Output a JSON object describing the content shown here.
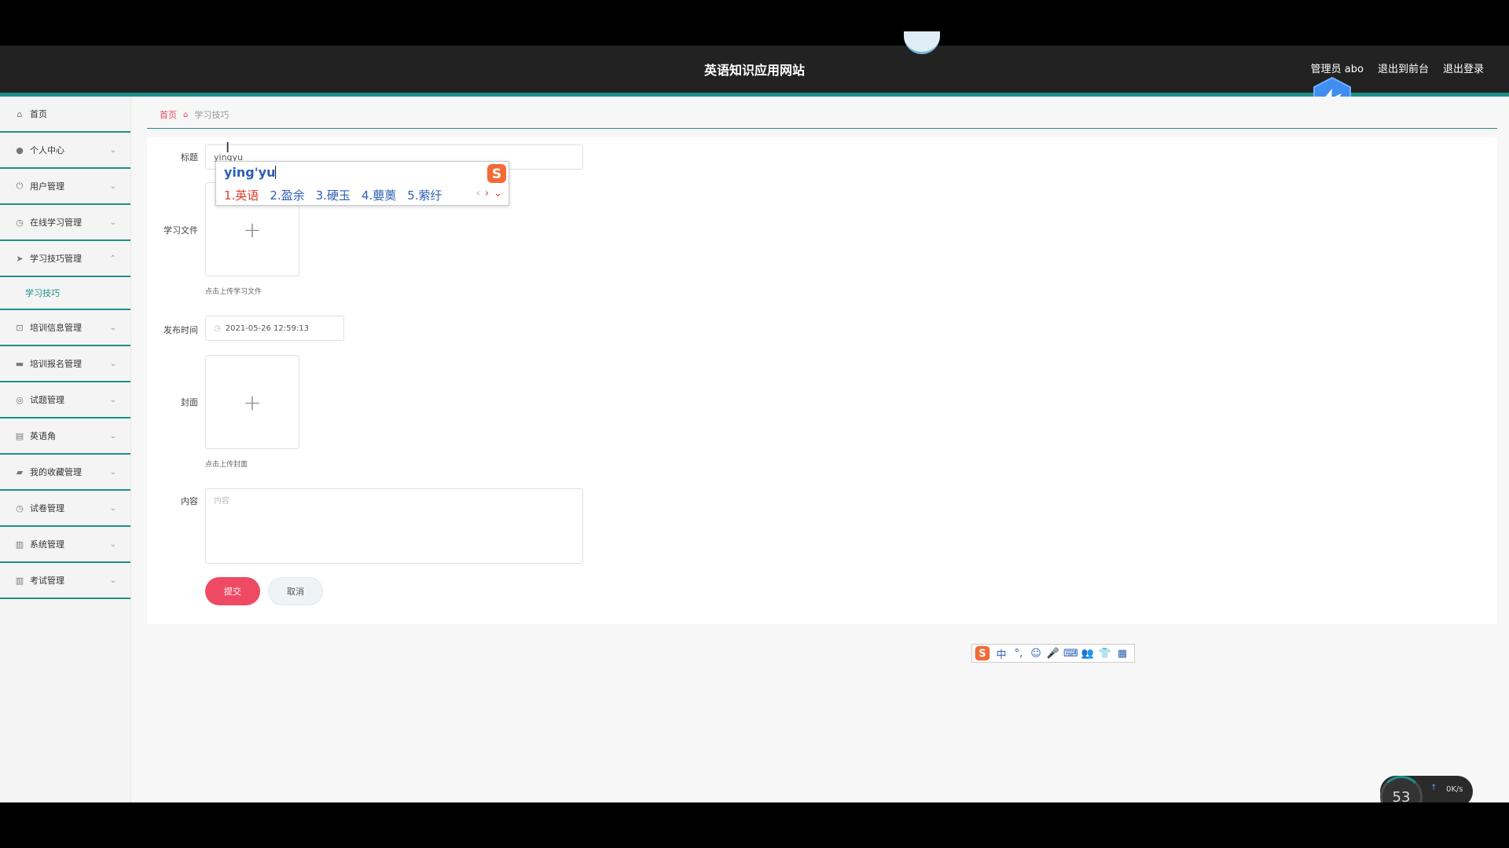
{
  "header": {
    "site_title": "英语知识应用网站",
    "admin_label": "管理员 abo",
    "back_to_front": "退出到前台",
    "logout": "退出登录"
  },
  "sidebar": {
    "items": [
      {
        "label": "首页",
        "icon": "home-icon"
      },
      {
        "label": "个人中心",
        "icon": "user-icon"
      },
      {
        "label": "用户管理",
        "icon": "power-icon"
      },
      {
        "label": "在线学习管理",
        "icon": "clock-icon"
      },
      {
        "label": "学习技巧管理",
        "icon": "send-icon"
      },
      {
        "label": "学习技巧",
        "icon": ""
      },
      {
        "label": "培训信息管理",
        "icon": "crop-icon"
      },
      {
        "label": "培训报名管理",
        "icon": "chat-icon"
      },
      {
        "label": "试题管理",
        "icon": "target-icon"
      },
      {
        "label": "英语角",
        "icon": "briefcase-icon"
      },
      {
        "label": "我的收藏管理",
        "icon": "bookmark-icon"
      },
      {
        "label": "试卷管理",
        "icon": "clock-icon"
      },
      {
        "label": "系统管理",
        "icon": "clipboard-icon"
      },
      {
        "label": "考试管理",
        "icon": "clipboard-icon"
      }
    ]
  },
  "breadcrumb": {
    "home": "首页",
    "current": "学习技巧"
  },
  "form": {
    "title_label": "标题",
    "title_value": "yingyu",
    "file_label": "学习文件",
    "file_hint": "点击上传学习文件",
    "time_label": "发布时间",
    "time_value": "2021-05-26 12:59:13",
    "cover_label": "封面",
    "cover_hint": "点击上传封面",
    "content_label": "内容",
    "content_placeholder": "内容",
    "submit": "提交",
    "cancel": "取消"
  },
  "ime": {
    "composition": "ying'yu",
    "candidates": [
      "1.英语",
      "2.盈余",
      "3.硬玉",
      "4.蘡薁",
      "5.萦纡"
    ],
    "toolbar": [
      "中",
      "°,",
      "☺",
      "🎤",
      "⌨",
      "👥",
      "👕",
      "▦"
    ]
  },
  "widget": {
    "percent": "53",
    "net_speed": "0K/s"
  }
}
